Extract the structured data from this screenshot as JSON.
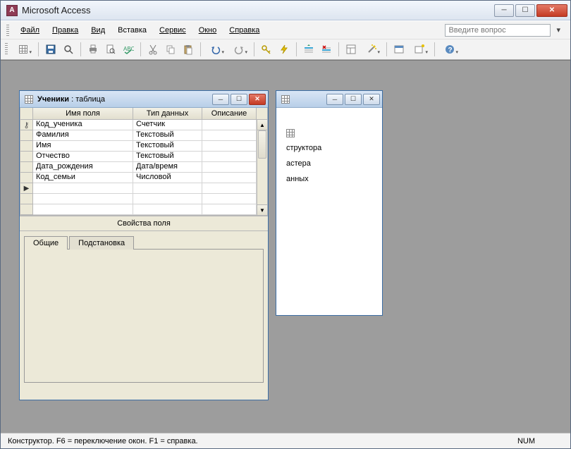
{
  "app": {
    "title": "Microsoft Access",
    "question_placeholder": "Введите вопрос"
  },
  "menu": {
    "file": "Файл",
    "edit": "Правка",
    "view": "Вид",
    "insert": "Вставка",
    "service": "Сервис",
    "window": "Окно",
    "help": "Справка"
  },
  "back_window": {
    "items": {
      "a": "структора",
      "b": "астера",
      "c": "анных"
    }
  },
  "table_designer": {
    "title_prefix": "Ученики",
    "title_suffix": " : таблица",
    "col_field_name": "Имя поля",
    "col_data_type": "Тип данных",
    "col_description": "Описание",
    "rows": [
      {
        "key": true,
        "name": "Код_ученика",
        "type": "Счетчик"
      },
      {
        "key": false,
        "name": "Фамилия",
        "type": "Текстовый"
      },
      {
        "key": false,
        "name": "Имя",
        "type": "Текстовый"
      },
      {
        "key": false,
        "name": "Отчество",
        "type": "Текстовый"
      },
      {
        "key": false,
        "name": "Дата_рождения",
        "type": "Дата/время"
      },
      {
        "key": false,
        "name": "Код_семьи",
        "type": "Числовой"
      }
    ],
    "props_caption": "Свойства поля",
    "tab_general": "Общие",
    "tab_lookup": "Подстановка"
  },
  "statusbar": {
    "left": "Конструктор.  F6 = переключение окон.  F1 = справка.",
    "right": "NUM"
  }
}
